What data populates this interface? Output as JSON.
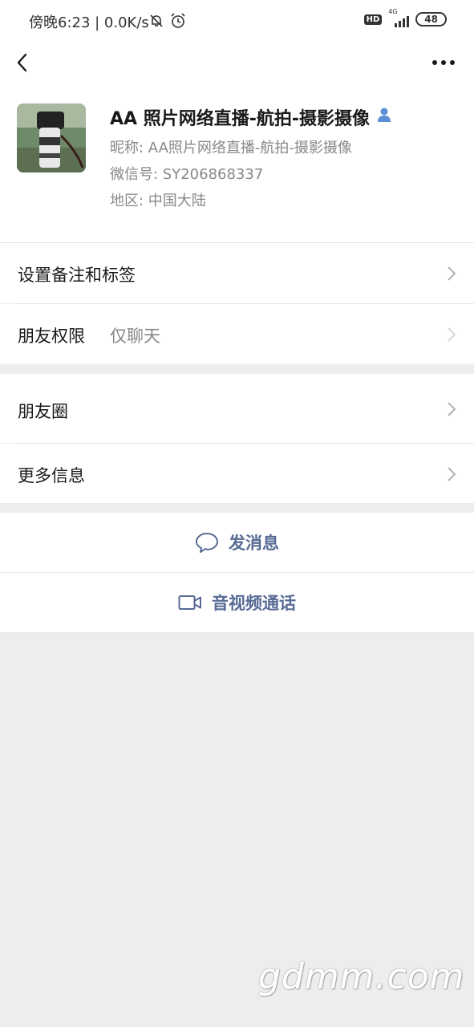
{
  "status_bar": {
    "time": "傍晚6:23 | 0.0K/s",
    "hd": "HD",
    "network": "4G",
    "battery": "48"
  },
  "nav": {
    "back_icon": "chevron-left-icon",
    "more_icon": "more-dots-icon"
  },
  "profile": {
    "name": "AA 照片网络直播-航拍-摄影摄像",
    "nickname": "昵称:  AA照片网络直播-航拍-摄影摄像",
    "wechat_id": "微信号:  SY206868337",
    "region": "地区:  中国大陆"
  },
  "rows": {
    "remark": "设置备注和标签",
    "permission_label": "朋友权限",
    "permission_value": "仅聊天",
    "moments": "朋友圈",
    "more_info": "更多信息"
  },
  "actions": {
    "message": "发消息",
    "call": "音视频通话"
  },
  "colors": {
    "link_blue": "#576b95",
    "background": "#ededed"
  },
  "watermark": "gdmm.com"
}
